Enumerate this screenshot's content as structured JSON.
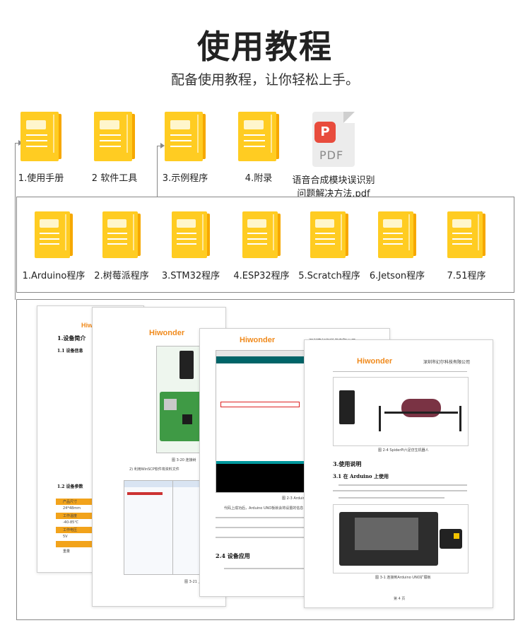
{
  "header": {
    "title": "使用教程",
    "subtitle": "配备使用教程，让你轻松上手。"
  },
  "top_items": [
    {
      "label": "1.使用手册",
      "icon": "folder-icon"
    },
    {
      "label": "2 软件工具",
      "icon": "folder-icon"
    },
    {
      "label": "3.示例程序",
      "icon": "folder-icon"
    },
    {
      "label": "4.附录",
      "icon": "folder-icon"
    },
    {
      "label_line1": "语音合成模块误识别",
      "label_line2": "问题解决方法.pdf",
      "icon": "pdf-icon",
      "pdf_text": "PDF"
    }
  ],
  "sub_items": [
    {
      "label": "1.Arduino程序"
    },
    {
      "label": "2.树莓派程序"
    },
    {
      "label": "3.STM32程序"
    },
    {
      "label": "4.ESP32程序"
    },
    {
      "label": "5.Scratch程序"
    },
    {
      "label": "6.Jetson程序"
    },
    {
      "label": "7.51程序"
    }
  ],
  "docs": {
    "brand": "Hiwonder",
    "company": "深圳市幻尔科技有限公司",
    "doc1": {
      "h1": "1.设备简介",
      "h2": "1.1 设备信息",
      "h3": "1.2 设备参数",
      "table": [
        "产品尺寸",
        "24*48mm",
        "工作温度",
        "-40-85℃",
        "工作电压",
        "5V",
        "重量"
      ]
    },
    "doc2": {
      "step": "2)  利用WinSCP软件将资料文件",
      "fig1": "图 3-20 连接树",
      "fig2": "图 3-21 上传"
    },
    "doc3": {
      "fig": "图 2-3 Arduino",
      "h": "2.4 设备应用",
      "p": "代码上成功后，Arduino UNO板就会将设置的信息"
    },
    "doc4": {
      "fig1": "图 2-4 SpiderPi六足仿生机器人",
      "h1": "3.使用说明",
      "h2": "3.1 在 Arduino 上使用",
      "fig2": "图 3-1 连接到Arduino UNO扩展板",
      "pageno": "第 4 页"
    }
  },
  "colors": {
    "folder": "#ffcc22",
    "folder_back": "#f6a800",
    "pdf_red": "#e84c3d",
    "brand_orange": "#f08a1c"
  }
}
